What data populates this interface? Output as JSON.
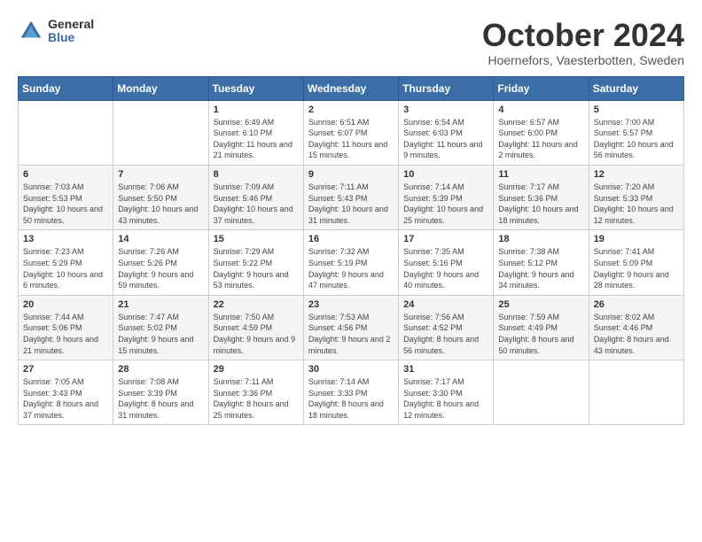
{
  "logo": {
    "general": "General",
    "blue": "Blue"
  },
  "title": "October 2024",
  "subtitle": "Hoernefors, Vaesterbotten, Sweden",
  "weekdays": [
    "Sunday",
    "Monday",
    "Tuesday",
    "Wednesday",
    "Thursday",
    "Friday",
    "Saturday"
  ],
  "weeks": [
    [
      {
        "day": "",
        "info": ""
      },
      {
        "day": "",
        "info": ""
      },
      {
        "day": "1",
        "info": "Sunrise: 6:49 AM\nSunset: 6:10 PM\nDaylight: 11 hours and 21 minutes."
      },
      {
        "day": "2",
        "info": "Sunrise: 6:51 AM\nSunset: 6:07 PM\nDaylight: 11 hours and 15 minutes."
      },
      {
        "day": "3",
        "info": "Sunrise: 6:54 AM\nSunset: 6:03 PM\nDaylight: 11 hours and 9 minutes."
      },
      {
        "day": "4",
        "info": "Sunrise: 6:57 AM\nSunset: 6:00 PM\nDaylight: 11 hours and 2 minutes."
      },
      {
        "day": "5",
        "info": "Sunrise: 7:00 AM\nSunset: 5:57 PM\nDaylight: 10 hours and 56 minutes."
      }
    ],
    [
      {
        "day": "6",
        "info": "Sunrise: 7:03 AM\nSunset: 5:53 PM\nDaylight: 10 hours and 50 minutes."
      },
      {
        "day": "7",
        "info": "Sunrise: 7:06 AM\nSunset: 5:50 PM\nDaylight: 10 hours and 43 minutes."
      },
      {
        "day": "8",
        "info": "Sunrise: 7:09 AM\nSunset: 5:46 PM\nDaylight: 10 hours and 37 minutes."
      },
      {
        "day": "9",
        "info": "Sunrise: 7:11 AM\nSunset: 5:43 PM\nDaylight: 10 hours and 31 minutes."
      },
      {
        "day": "10",
        "info": "Sunrise: 7:14 AM\nSunset: 5:39 PM\nDaylight: 10 hours and 25 minutes."
      },
      {
        "day": "11",
        "info": "Sunrise: 7:17 AM\nSunset: 5:36 PM\nDaylight: 10 hours and 18 minutes."
      },
      {
        "day": "12",
        "info": "Sunrise: 7:20 AM\nSunset: 5:33 PM\nDaylight: 10 hours and 12 minutes."
      }
    ],
    [
      {
        "day": "13",
        "info": "Sunrise: 7:23 AM\nSunset: 5:29 PM\nDaylight: 10 hours and 6 minutes."
      },
      {
        "day": "14",
        "info": "Sunrise: 7:26 AM\nSunset: 5:26 PM\nDaylight: 9 hours and 59 minutes."
      },
      {
        "day": "15",
        "info": "Sunrise: 7:29 AM\nSunset: 5:22 PM\nDaylight: 9 hours and 53 minutes."
      },
      {
        "day": "16",
        "info": "Sunrise: 7:32 AM\nSunset: 5:19 PM\nDaylight: 9 hours and 47 minutes."
      },
      {
        "day": "17",
        "info": "Sunrise: 7:35 AM\nSunset: 5:16 PM\nDaylight: 9 hours and 40 minutes."
      },
      {
        "day": "18",
        "info": "Sunrise: 7:38 AM\nSunset: 5:12 PM\nDaylight: 9 hours and 34 minutes."
      },
      {
        "day": "19",
        "info": "Sunrise: 7:41 AM\nSunset: 5:09 PM\nDaylight: 9 hours and 28 minutes."
      }
    ],
    [
      {
        "day": "20",
        "info": "Sunrise: 7:44 AM\nSunset: 5:06 PM\nDaylight: 9 hours and 21 minutes."
      },
      {
        "day": "21",
        "info": "Sunrise: 7:47 AM\nSunset: 5:02 PM\nDaylight: 9 hours and 15 minutes."
      },
      {
        "day": "22",
        "info": "Sunrise: 7:50 AM\nSunset: 4:59 PM\nDaylight: 9 hours and 9 minutes."
      },
      {
        "day": "23",
        "info": "Sunrise: 7:53 AM\nSunset: 4:56 PM\nDaylight: 9 hours and 2 minutes."
      },
      {
        "day": "24",
        "info": "Sunrise: 7:56 AM\nSunset: 4:52 PM\nDaylight: 8 hours and 56 minutes."
      },
      {
        "day": "25",
        "info": "Sunrise: 7:59 AM\nSunset: 4:49 PM\nDaylight: 8 hours and 50 minutes."
      },
      {
        "day": "26",
        "info": "Sunrise: 8:02 AM\nSunset: 4:46 PM\nDaylight: 8 hours and 43 minutes."
      }
    ],
    [
      {
        "day": "27",
        "info": "Sunrise: 7:05 AM\nSunset: 3:43 PM\nDaylight: 8 hours and 37 minutes."
      },
      {
        "day": "28",
        "info": "Sunrise: 7:08 AM\nSunset: 3:39 PM\nDaylight: 8 hours and 31 minutes."
      },
      {
        "day": "29",
        "info": "Sunrise: 7:11 AM\nSunset: 3:36 PM\nDaylight: 8 hours and 25 minutes."
      },
      {
        "day": "30",
        "info": "Sunrise: 7:14 AM\nSunset: 3:33 PM\nDaylight: 8 hours and 18 minutes."
      },
      {
        "day": "31",
        "info": "Sunrise: 7:17 AM\nSunset: 3:30 PM\nDaylight: 8 hours and 12 minutes."
      },
      {
        "day": "",
        "info": ""
      },
      {
        "day": "",
        "info": ""
      }
    ]
  ]
}
